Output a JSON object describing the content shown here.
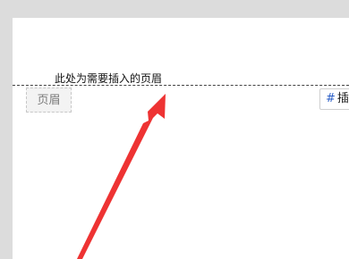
{
  "document": {
    "header_placeholder_text": "此处为需要插入的页眉",
    "header_tag_label": "页眉"
  },
  "toolbar": {
    "insert_button_label": "插",
    "insert_button_icon": "hash-icon"
  },
  "annotation": {
    "arrow_color": "#ee3333"
  }
}
